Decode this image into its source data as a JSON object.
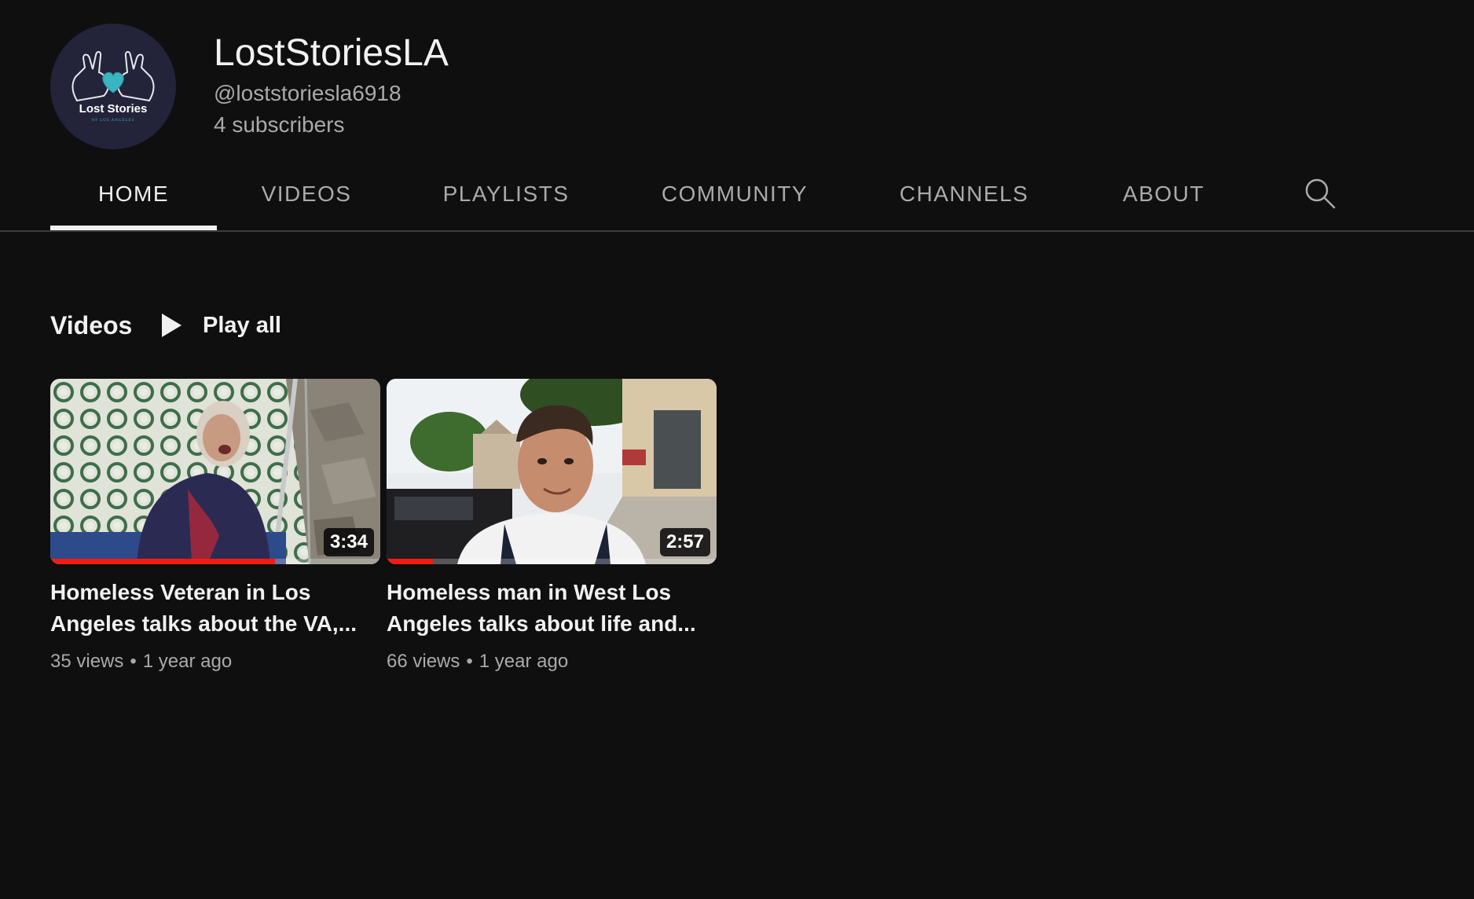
{
  "channel": {
    "name": "LostStoriesLA",
    "handle": "@loststoriesla6918",
    "subscribers": "4 subscribers",
    "avatar": {
      "text": "Lost Stories",
      "subtext": "OF LOS ANGELES",
      "background": "#23233a",
      "heart_color": "#3bb4c1"
    }
  },
  "tabs": [
    {
      "label": "HOME",
      "active": true
    },
    {
      "label": "VIDEOS",
      "active": false
    },
    {
      "label": "PLAYLISTS",
      "active": false
    },
    {
      "label": "COMMUNITY",
      "active": false
    },
    {
      "label": "CHANNELS",
      "active": false
    },
    {
      "label": "ABOUT",
      "active": false
    }
  ],
  "search": {
    "icon": "search-icon"
  },
  "section": {
    "title": "Videos",
    "play_all_label": "Play all",
    "play_icon": "play-icon"
  },
  "videos": [
    {
      "duration": "3:34",
      "title": "Homeless Veteran in Los Angeles talks about the VA,...",
      "views": "35 views",
      "age": "1 year ago",
      "watched_fraction": 0.68
    },
    {
      "duration": "2:57",
      "title": "Homeless man in West Los Angeles talks about life and...",
      "views": "66 views",
      "age": "1 year ago",
      "watched_fraction": 0.14
    }
  ],
  "colors": {
    "background": "#0f0f0f",
    "text_primary": "#f1f1f1",
    "text_secondary": "#aaaaaa",
    "progress": "#f21d12"
  }
}
